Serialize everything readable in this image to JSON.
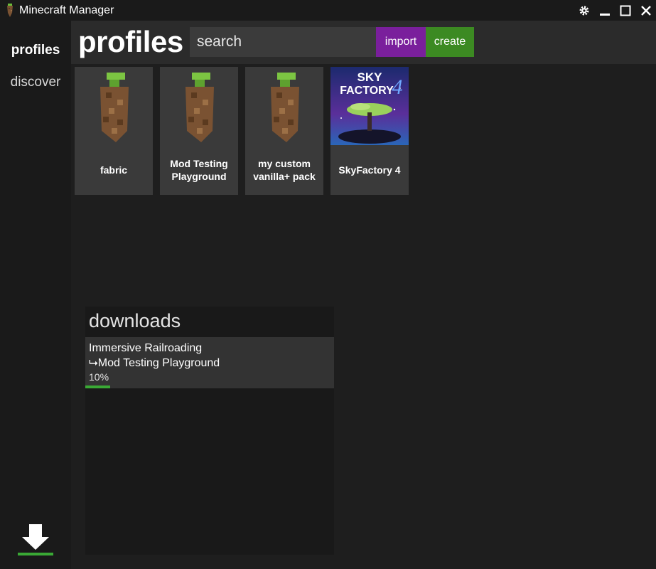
{
  "window": {
    "title": "Minecraft Manager",
    "icons": [
      "tree-icon",
      "gear-icon",
      "minimize-icon",
      "maximize-icon",
      "close-icon"
    ]
  },
  "sidebar": {
    "items": [
      {
        "label": "profiles",
        "active": true
      },
      {
        "label": "discover",
        "active": false
      }
    ],
    "downloads_icon": "download-icon"
  },
  "header": {
    "title": "profiles",
    "search_placeholder": "search",
    "import_label": "import",
    "create_label": "create"
  },
  "profiles": [
    {
      "name": "fabric",
      "icon": "grass-tree-icon"
    },
    {
      "name": "Mod Testing Playground",
      "icon": "grass-tree-icon"
    },
    {
      "name": "my custom vanilla+ pack",
      "icon": "grass-tree-icon"
    },
    {
      "name": "SkyFactory 4",
      "icon": "skyfactory-logo",
      "logo_text": "SKY FACTORY 4"
    }
  ],
  "downloads": {
    "title": "downloads",
    "items": [
      {
        "name": "Immersive Railroading",
        "target": "⮡Mod Testing Playground",
        "percent_label": "10%",
        "progress": 0.1
      }
    ]
  },
  "colors": {
    "import": "#7a1f9c",
    "create": "#3c8a22",
    "progress": "#3aa935"
  }
}
